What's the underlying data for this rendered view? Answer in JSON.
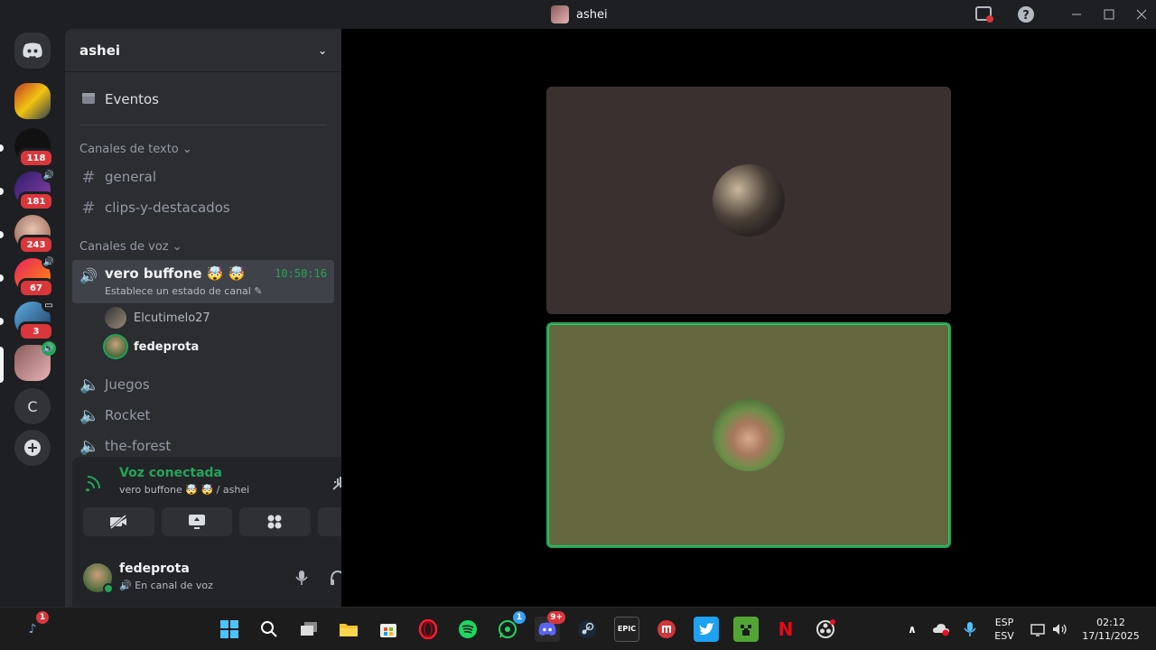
{
  "window": {
    "title": "ashei"
  },
  "rail": {
    "servers": [
      {
        "name": "server-1",
        "badge": ""
      },
      {
        "name": "server-2",
        "badge": "118"
      },
      {
        "name": "server-3",
        "badge": "181"
      },
      {
        "name": "server-4",
        "badge": "243"
      },
      {
        "name": "server-5",
        "badge": "67"
      },
      {
        "name": "server-6",
        "badge": "3"
      },
      {
        "name": "server-ashei",
        "badge": ""
      }
    ],
    "letter_server": "C"
  },
  "guild": {
    "name": "ashei"
  },
  "sidebar": {
    "events_label": "Eventos",
    "text_category": "Canales de texto",
    "text_channels": [
      "general",
      "clips-y-destacados"
    ],
    "voice_category": "Canales de voz",
    "active_voice": {
      "name": "vero buffone 🤯 🤯",
      "status": "Establece un estado de canal",
      "timer": "10:50:16",
      "users": [
        "Elcutimelo27",
        "fedeprota"
      ]
    },
    "voice_channels": [
      "Juegos",
      "Rocket",
      "the-forest"
    ]
  },
  "voice_panel": {
    "title": "Voz conectada",
    "subtitle": "vero buffone 🤯 🤯 / ashei"
  },
  "user": {
    "name": "fedeprota",
    "status": "En canal de voz"
  },
  "taskbar": {
    "badges": {
      "notif": "1",
      "whatsapp": "1",
      "discord": "9+"
    },
    "lang": "ESP",
    "layout": "ESV",
    "time": "02:12",
    "date": "17/11/2025",
    "epic": "EPIC"
  },
  "colors": {
    "accent_green": "#23a559",
    "badge_red": "#da373c",
    "blurple": "#5865f2"
  }
}
